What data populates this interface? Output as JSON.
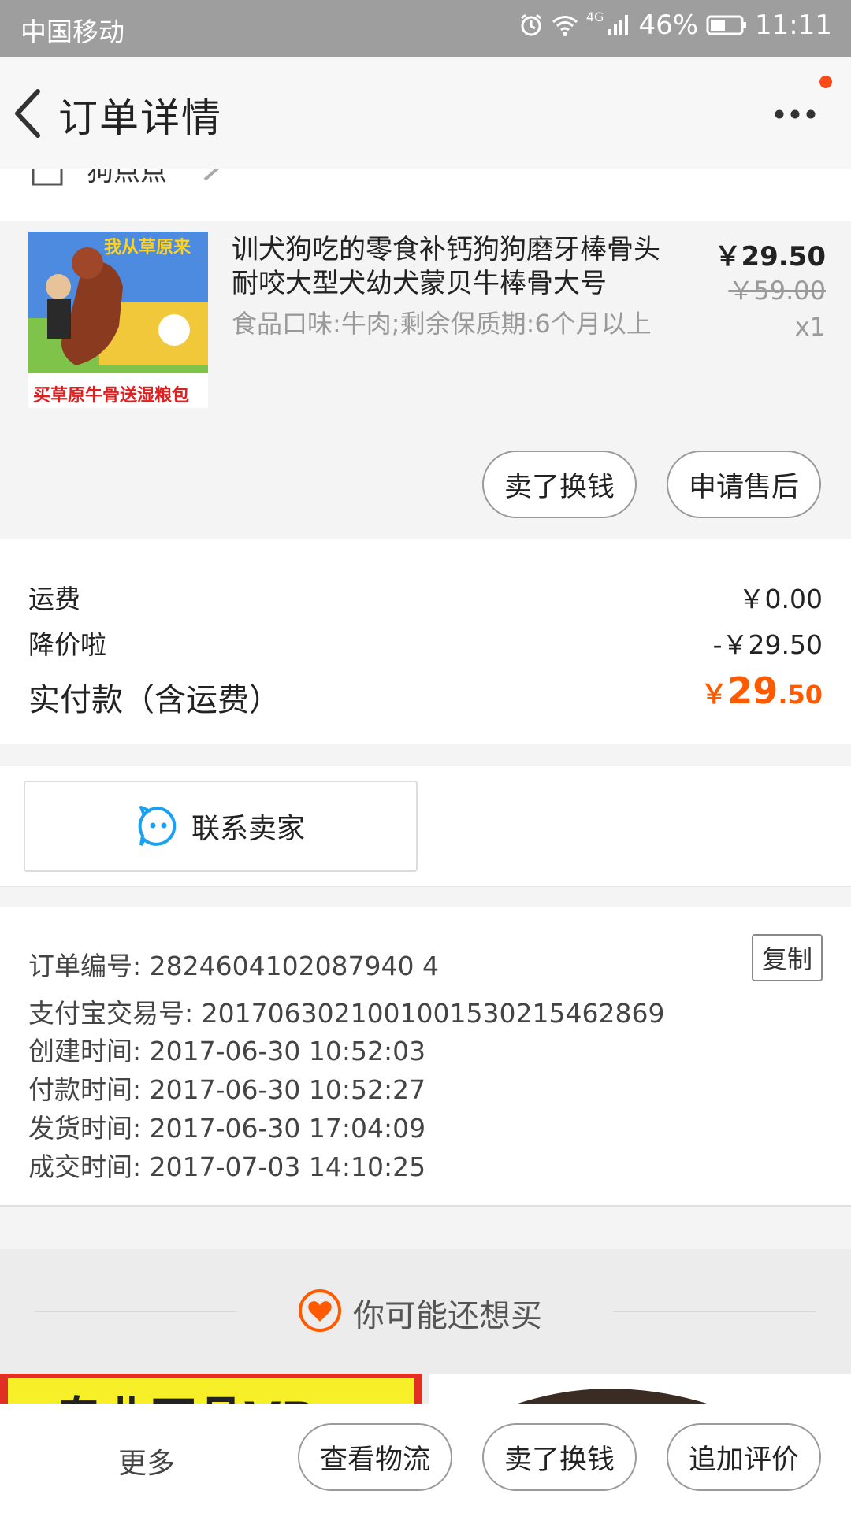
{
  "status_bar": {
    "carrier": "中国移动",
    "network": "4G",
    "battery": "46%",
    "time": "11:11"
  },
  "header": {
    "title": "订单详情"
  },
  "shop": {
    "name": "狗点点"
  },
  "product": {
    "title": "训犬狗吃的零食补钙狗狗磨牙棒骨头耐咬大型犬幼犬蒙贝牛棒骨大号",
    "sku": "食品口味:牛肉;剩余保质期:6个月以上",
    "price": "￥29.50",
    "original_price": "￥59.00",
    "quantity": "x1",
    "thumb_top_text": "我从草原来",
    "thumb_bottom_text_1": "买草原牛骨",
    "thumb_bottom_text_2": "送湿粮包",
    "actions": {
      "sell": "卖了换钱",
      "after_sale": "申请售后"
    }
  },
  "fees": {
    "shipping_label": "运费",
    "shipping_value": "￥0.00",
    "discount_label": "降价啦",
    "discount_value": "-￥29.50",
    "total_label": "实付款（含运费）",
    "total_currency": "￥",
    "total_int": "29",
    "total_dec": ".50"
  },
  "contact": {
    "label": "联系卖家"
  },
  "order_info": {
    "order_no": "订单编号: 2824604102087940 4",
    "alipay_no": "支付宝交易号: 2017063021001001530215462869",
    "created": "创建时间: 2017-06-30 10:52:03",
    "paid": "付款时间: 2017-06-30 10:52:27",
    "shipped": "发货时间: 2017-06-30 17:04:09",
    "completed": "成交时间: 2017-07-03 14:10:25",
    "copy_label": "复制"
  },
  "recommend": {
    "title": "你可能还想买",
    "banner_text": "专业正品VP"
  },
  "bottom_bar": {
    "more": "更多",
    "logistics": "查看物流",
    "sell": "卖了换钱",
    "review": "追加评价"
  },
  "colors": {
    "accent": "#ff5a00",
    "notify": "#ff4a18",
    "contact_icon": "#1ba1f2"
  }
}
